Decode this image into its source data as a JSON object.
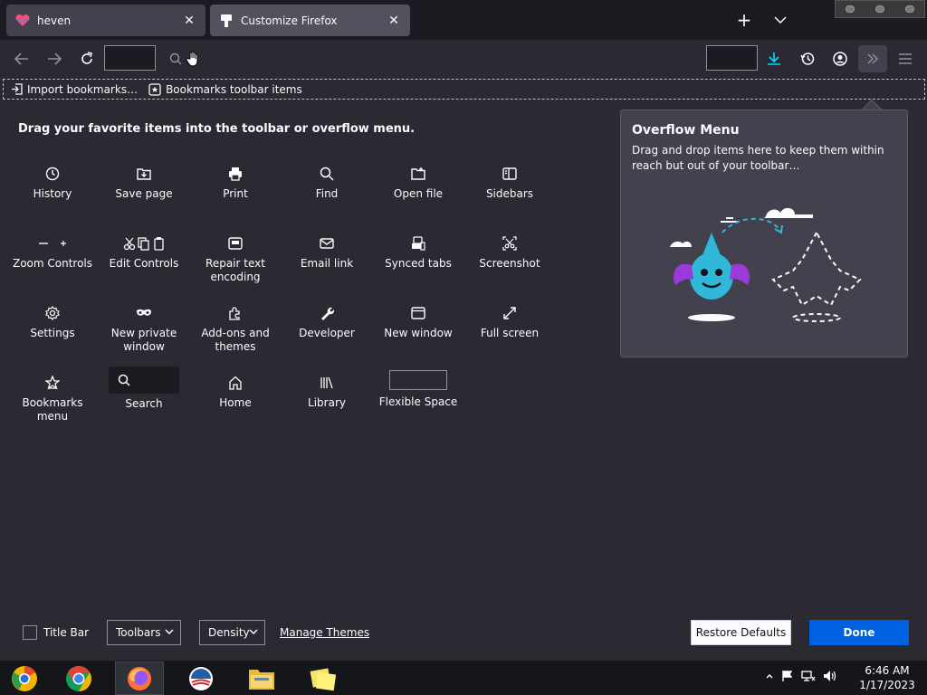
{
  "browser": {
    "tabs": [
      {
        "title": "heven",
        "favicon": "heven-favicon"
      },
      {
        "title": "Customize Firefox",
        "favicon": "customize-favicon"
      }
    ]
  },
  "bookmarks_toolbar": {
    "items": [
      {
        "label": "Import bookmarks…",
        "icon": "import-icon"
      },
      {
        "label": "Bookmarks toolbar items",
        "icon": "bookmark-star-icon"
      }
    ]
  },
  "customize": {
    "intro": "Drag your favorite items into the toolbar or overflow menu.",
    "palette": [
      {
        "label": "History",
        "icon": "history-icon"
      },
      {
        "label": "Save page",
        "icon": "save-page-icon"
      },
      {
        "label": "Print",
        "icon": "print-icon"
      },
      {
        "label": "Find",
        "icon": "find-icon"
      },
      {
        "label": "Open file",
        "icon": "open-file-icon"
      },
      {
        "label": "Sidebars",
        "icon": "sidebars-icon"
      },
      {
        "label": "Zoom Controls",
        "icon": "zoom-icon"
      },
      {
        "label": "Edit Controls",
        "icon": "edit-icon"
      },
      {
        "label": "Repair text encoding",
        "icon": "encoding-icon"
      },
      {
        "label": "Email link",
        "icon": "email-icon"
      },
      {
        "label": "Synced tabs",
        "icon": "synced-tabs-icon"
      },
      {
        "label": "Screenshot",
        "icon": "screenshot-icon"
      },
      {
        "label": "Settings",
        "icon": "settings-icon"
      },
      {
        "label": "New private window",
        "icon": "private-window-icon"
      },
      {
        "label": "Add-ons and themes",
        "icon": "addons-icon"
      },
      {
        "label": "Developer",
        "icon": "developer-icon"
      },
      {
        "label": "New window",
        "icon": "new-window-icon"
      },
      {
        "label": "Full screen",
        "icon": "fullscreen-icon"
      },
      {
        "label": "Bookmarks menu",
        "icon": "bookmarks-menu-icon"
      },
      {
        "label": "Search",
        "icon": "search-icon"
      },
      {
        "label": "Home",
        "icon": "home-icon"
      },
      {
        "label": "Library",
        "icon": "library-icon"
      },
      {
        "label": "Flexible Space",
        "icon": "flexible-space"
      }
    ],
    "overflow_panel": {
      "title": "Overflow Menu",
      "description": "Drag and drop items here to keep them within reach but out of your toolbar…"
    },
    "footer": {
      "title_bar": "Title Bar",
      "toolbars": "Toolbars",
      "density": "Density",
      "manage_themes": "Manage Themes",
      "restore_defaults": "Restore Defaults",
      "done": "Done"
    }
  },
  "taskbar": {
    "apps": [
      "chrome-canary-icon",
      "chrome-icon",
      "firefox-icon",
      "obama-logo-icon",
      "file-explorer-icon",
      "sticky-notes-icon"
    ],
    "time": "6:46 AM",
    "date": "1/17/2023"
  },
  "colors": {
    "accent": "#0061e0",
    "background": "#2b2a33",
    "tabstrip": "#1c1b22",
    "panel": "#42414d",
    "download_accent": "#00ddff"
  }
}
